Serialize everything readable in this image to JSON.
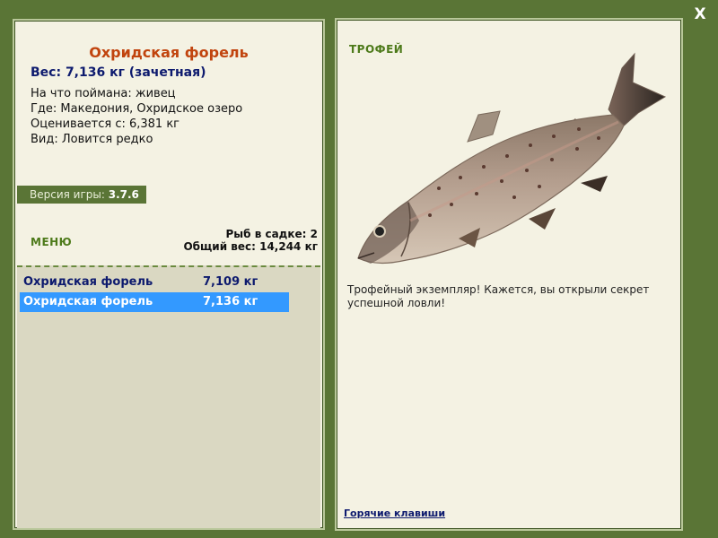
{
  "window": {
    "close_label": "X"
  },
  "fish": {
    "title": "Охридская форель",
    "weight_line": "Вес: 7,136 кг (зачетная)",
    "bait": "На что поймана: живец",
    "location": "Где: Македония, Охридское озеро",
    "rated_from": "Оценивается с: 6,381 кг",
    "kind": "Вид: Ловится редко"
  },
  "version": {
    "label": "Версия игры:",
    "value": "3.7.6"
  },
  "menu": {
    "label": "МЕНЮ"
  },
  "cage": {
    "count_label": "Рыб в садке: 2",
    "total_label": "Общий вес: 14,244 кг"
  },
  "catches": [
    {
      "name": "Охридская форель",
      "weight": "7,109 кг"
    },
    {
      "name": "Охридская форель",
      "weight": "7,136 кг"
    }
  ],
  "trophy": {
    "label": "ТРОФЕЙ",
    "text": "Трофейный экземпляр! Кажется, вы открыли секрет успешной ловли!"
  },
  "hotkeys": {
    "label": "Горячие клавиши"
  },
  "colors": {
    "background": "#5a7536",
    "panel": "#f4f2e3",
    "title": "#c1440e",
    "selected_row": "#3399ff",
    "accent_text": "#0d1a6e"
  },
  "icons": {
    "close": "close-icon",
    "fish": "trout-image"
  }
}
